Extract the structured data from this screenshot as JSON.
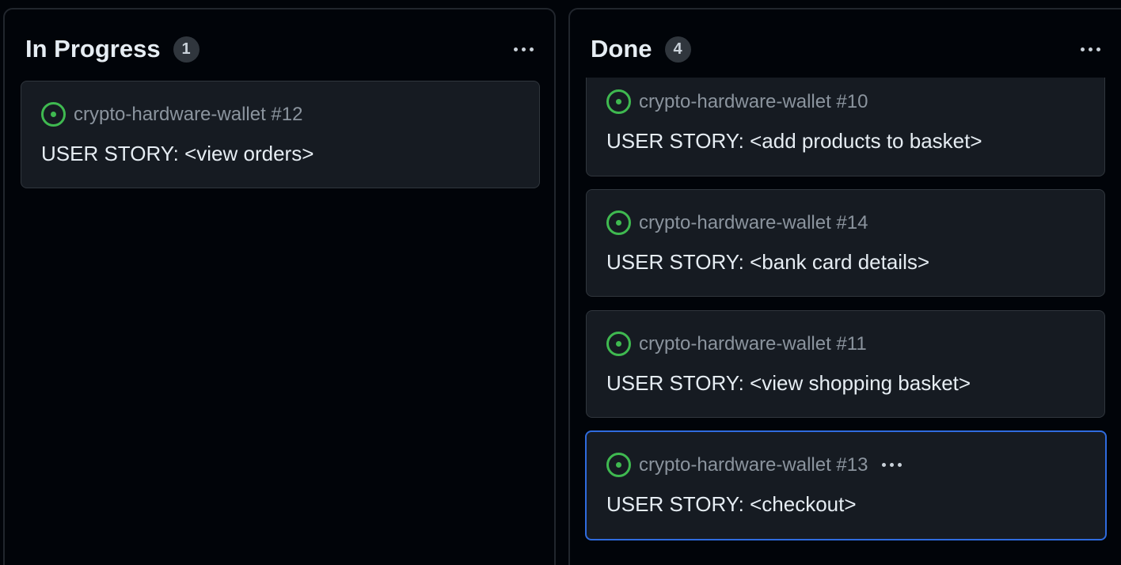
{
  "columns": [
    {
      "title": "In Progress",
      "count": "1",
      "cards": [
        {
          "repo": "crypto-hardware-wallet #12",
          "title": "USER STORY: <view orders>"
        }
      ]
    },
    {
      "title": "Done",
      "count": "4",
      "cards": [
        {
          "repo": "crypto-hardware-wallet #10",
          "title": "USER STORY: <add products to basket>"
        },
        {
          "repo": "crypto-hardware-wallet #14",
          "title": "USER STORY: <bank card details>"
        },
        {
          "repo": "crypto-hardware-wallet #11",
          "title": "USER STORY: <view shopping basket>"
        },
        {
          "repo": "crypto-hardware-wallet #13",
          "title": "USER STORY: <checkout>"
        }
      ]
    }
  ],
  "colors": {
    "background": "#010409",
    "card": "#161b22",
    "open_status": "#3fb950",
    "selected_border": "#2f6bde"
  },
  "icons": {
    "status": "issue-opened-icon",
    "menu": "kebab-horizontal-icon"
  }
}
